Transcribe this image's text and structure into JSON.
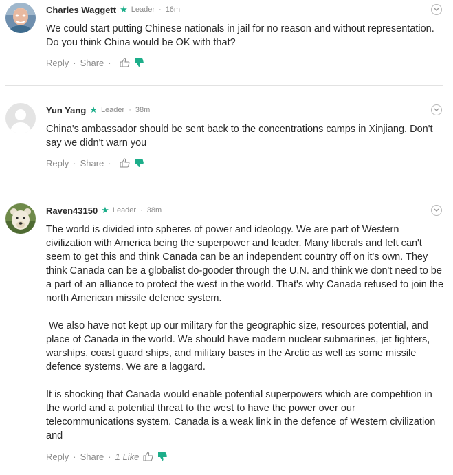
{
  "comments": [
    {
      "author": "Charles Waggett",
      "badge": "Leader",
      "time": "16m",
      "avatar_icon": "avatar-photo-elderly-man",
      "paragraphs": [
        "We could start putting Chinese nationals in jail for no reason and without representation. Do you think China would be OK with that?"
      ],
      "reply_label": "Reply",
      "share_label": "Share",
      "like_count": ""
    },
    {
      "author": "Yun Yang",
      "badge": "Leader",
      "time": "38m",
      "avatar_icon": "default-avatar-icon",
      "paragraphs": [
        "China's ambassador should be sent back to the concentrations camps in Xinjiang. Don't say we didn't warn you"
      ],
      "reply_label": "Reply",
      "share_label": "Share",
      "like_count": ""
    },
    {
      "author": "Raven43150",
      "badge": "Leader",
      "time": "38m",
      "avatar_icon": "avatar-photo-white-bear",
      "paragraphs": [
        "The world is divided into spheres of power and ideology. We are part of Western civilization with America being the superpower and leader. Many liberals and left can't seem to get this and think Canada can be an independent country off on it's own. They think Canada can be a globalist do-gooder through the U.N. and think we don't need to be a part of an alliance to protect the west in the world. That's why Canada refused to join the north American missile defence system.",
        " We also have not kept up our military for the geographic size, resources potential, and place of Canada in the world. We should have modern nuclear submarines, jet fighters, warships, coast guard ships, and military bases in the Arctic as well as some missile defence systems. We are a laggard.",
        "It is shocking that Canada would enable potential superpowers which are competition in the world and a potential threat to the west to have the power over our telecommunications system. Canada is a weak link in the defence of Western civilization and"
      ],
      "reply_label": "Reply",
      "share_label": "Share",
      "like_count": "1 Like"
    }
  ],
  "colors": {
    "accent": "#1dae8a",
    "text": "#2b2b2b",
    "muted": "#8a8a8a",
    "divider": "#e2e2e2"
  }
}
